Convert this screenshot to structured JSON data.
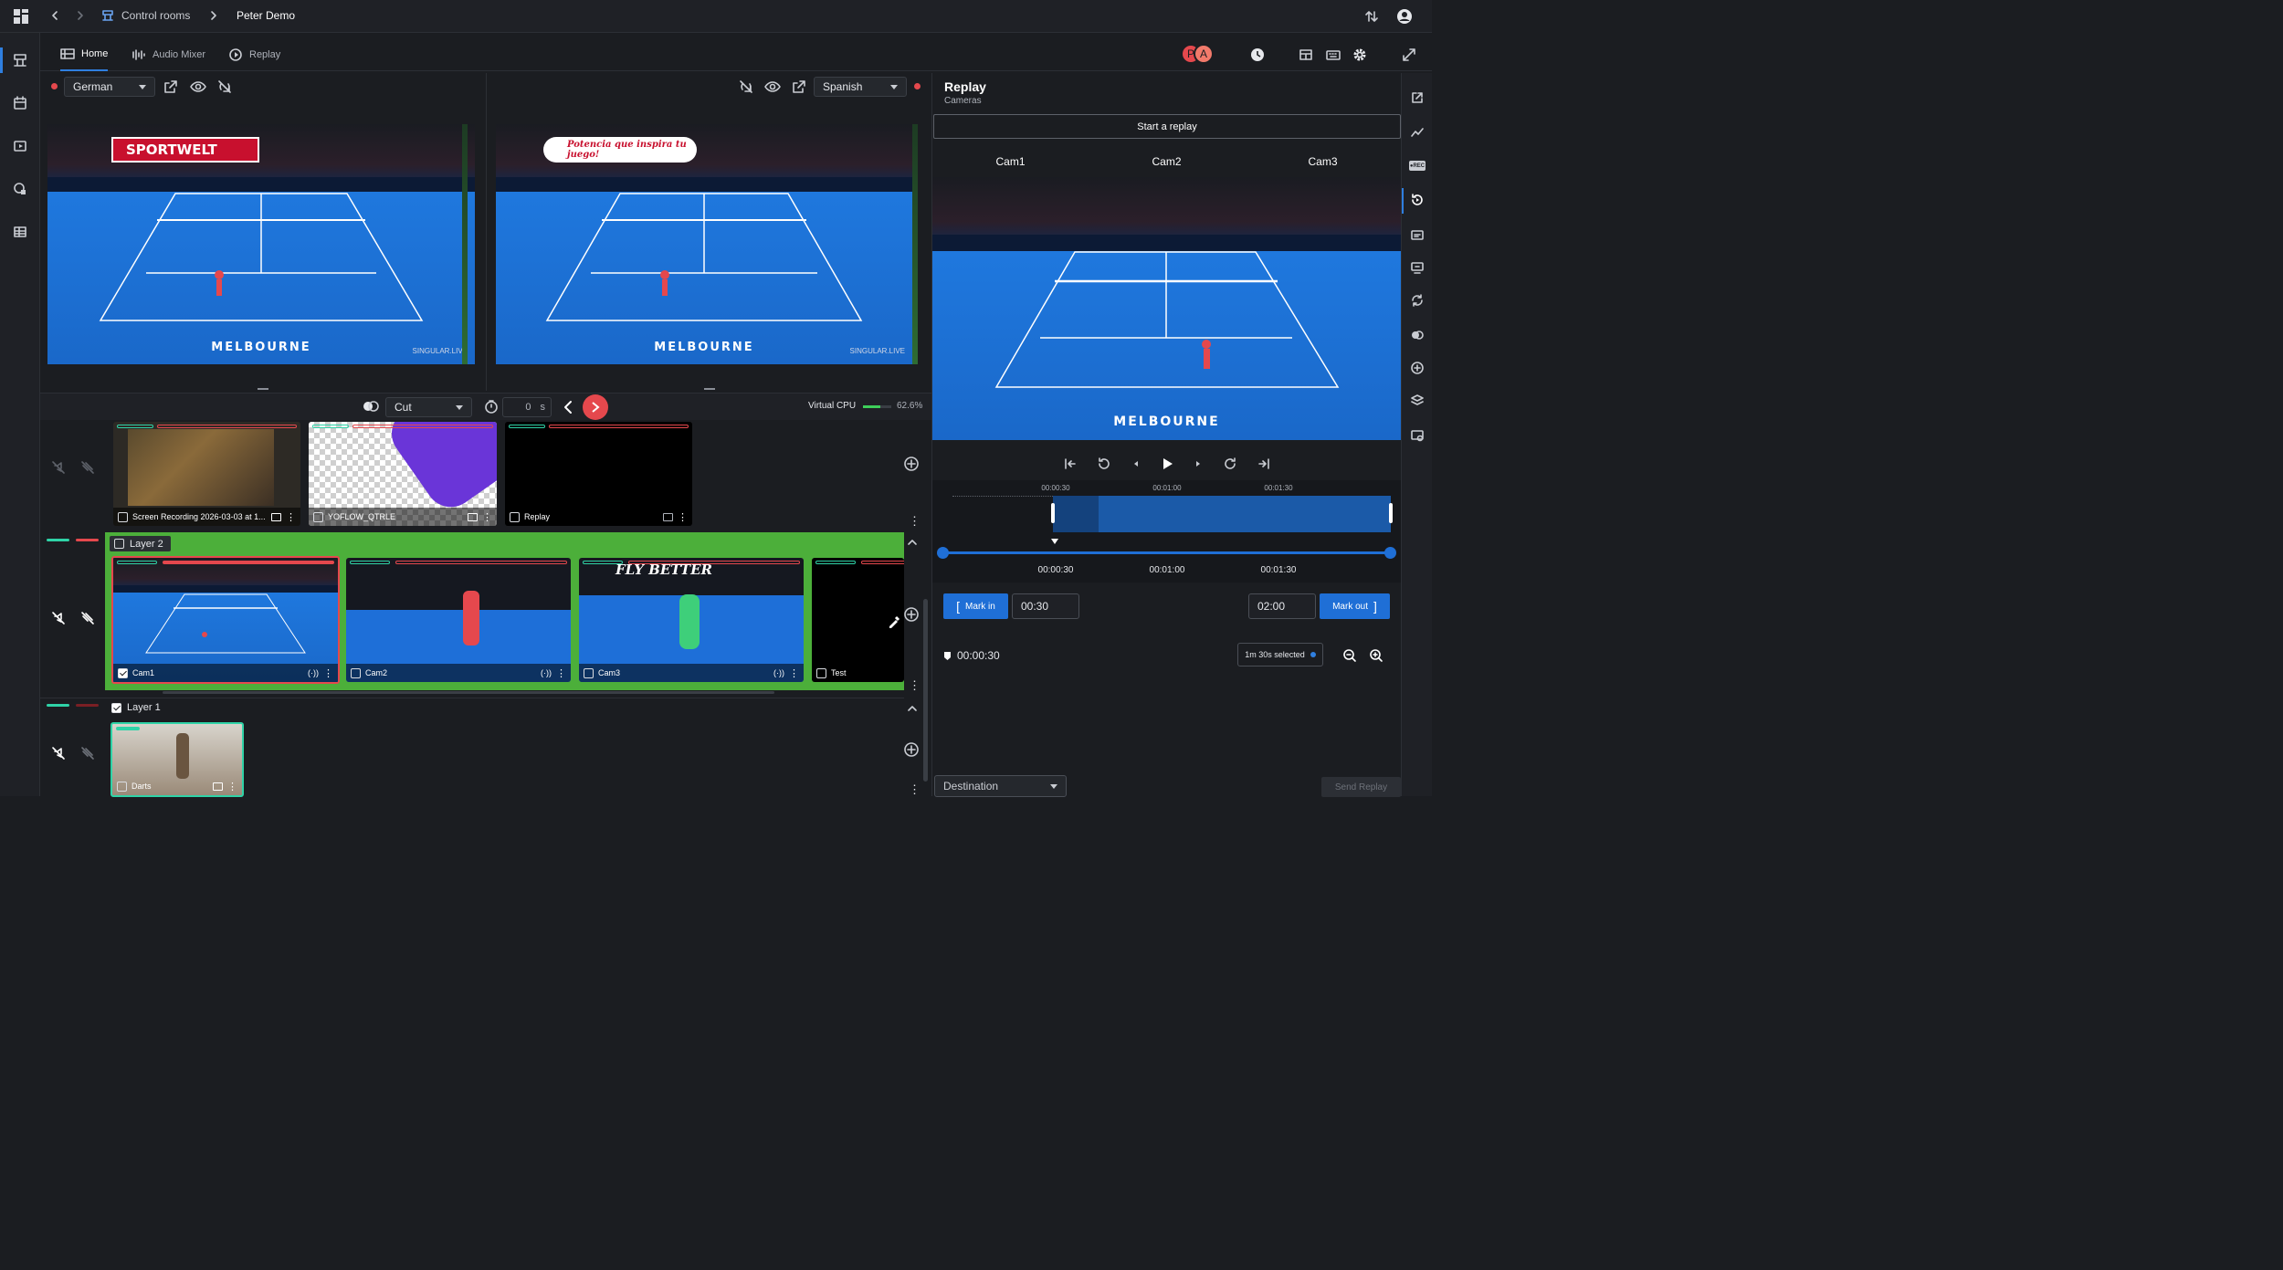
{
  "topbar": {
    "breadcrumb_1": "Control rooms",
    "breadcrumb_2": "Peter Demo"
  },
  "tabs": [
    {
      "label": "Home",
      "icon": "grid-icon"
    },
    {
      "label": "Audio Mixer",
      "icon": "equalizer-icon"
    },
    {
      "label": "Replay",
      "icon": "replay-icon"
    }
  ],
  "avatars": [
    "P",
    "A"
  ],
  "preview": {
    "language": "German",
    "watermark": "SINGULAR.LIVE",
    "venue": "MELBOURNE",
    "banner": "SPORTWELT"
  },
  "program": {
    "language": "Spanish",
    "watermark": "SINGULAR.LIVE",
    "venue": "MELBOURNE",
    "banner": "Potencia que inspira tu juego!"
  },
  "transition": {
    "type": "Cut",
    "duration": "0",
    "unit": "s"
  },
  "cpu": {
    "label": "Virtual CPU",
    "value": "62.6%",
    "fraction": 0.626
  },
  "sources": [
    {
      "label": "Screen Recording 2026-03-03 at 1..."
    },
    {
      "label": "YOFLOW_QTRLE"
    },
    {
      "label": "Replay"
    }
  ],
  "layer2": {
    "title": "Layer 2",
    "cams": [
      {
        "label": "Cam1",
        "checked": true
      },
      {
        "label": "Cam2",
        "checked": false
      },
      {
        "label": "Cam3",
        "checked": false
      },
      {
        "label": "Test",
        "checked": false
      }
    ],
    "overlay_text": "FLY BETTER"
  },
  "layer1": {
    "title": "Layer 1",
    "cams": [
      {
        "label": "Darts"
      }
    ]
  },
  "replay": {
    "title": "Replay",
    "subtitle": "Cameras",
    "start_button": "Start a replay",
    "cams": [
      "Cam1",
      "Cam2",
      "Cam3"
    ],
    "venue": "MELBOURNE",
    "timeline_ticks": [
      "00:00:30",
      "00:01:00",
      "00:01:30"
    ],
    "scrub_ticks": [
      "00:00:30",
      "00:01:00",
      "00:01:30"
    ],
    "mark_in_label": "Mark in",
    "mark_in_value": "00:30",
    "mark_out_value": "02:00",
    "mark_out_label": "Mark out",
    "current_time": "00:00:30",
    "selected_label": "1m 30s selected",
    "destination_placeholder": "Destination",
    "send_button": "Send Replay"
  },
  "colors": {
    "accent": "#1f6fd6",
    "live_red": "#e5484d",
    "layer_green": "#4caf3a",
    "teal": "#2fd3a7"
  }
}
